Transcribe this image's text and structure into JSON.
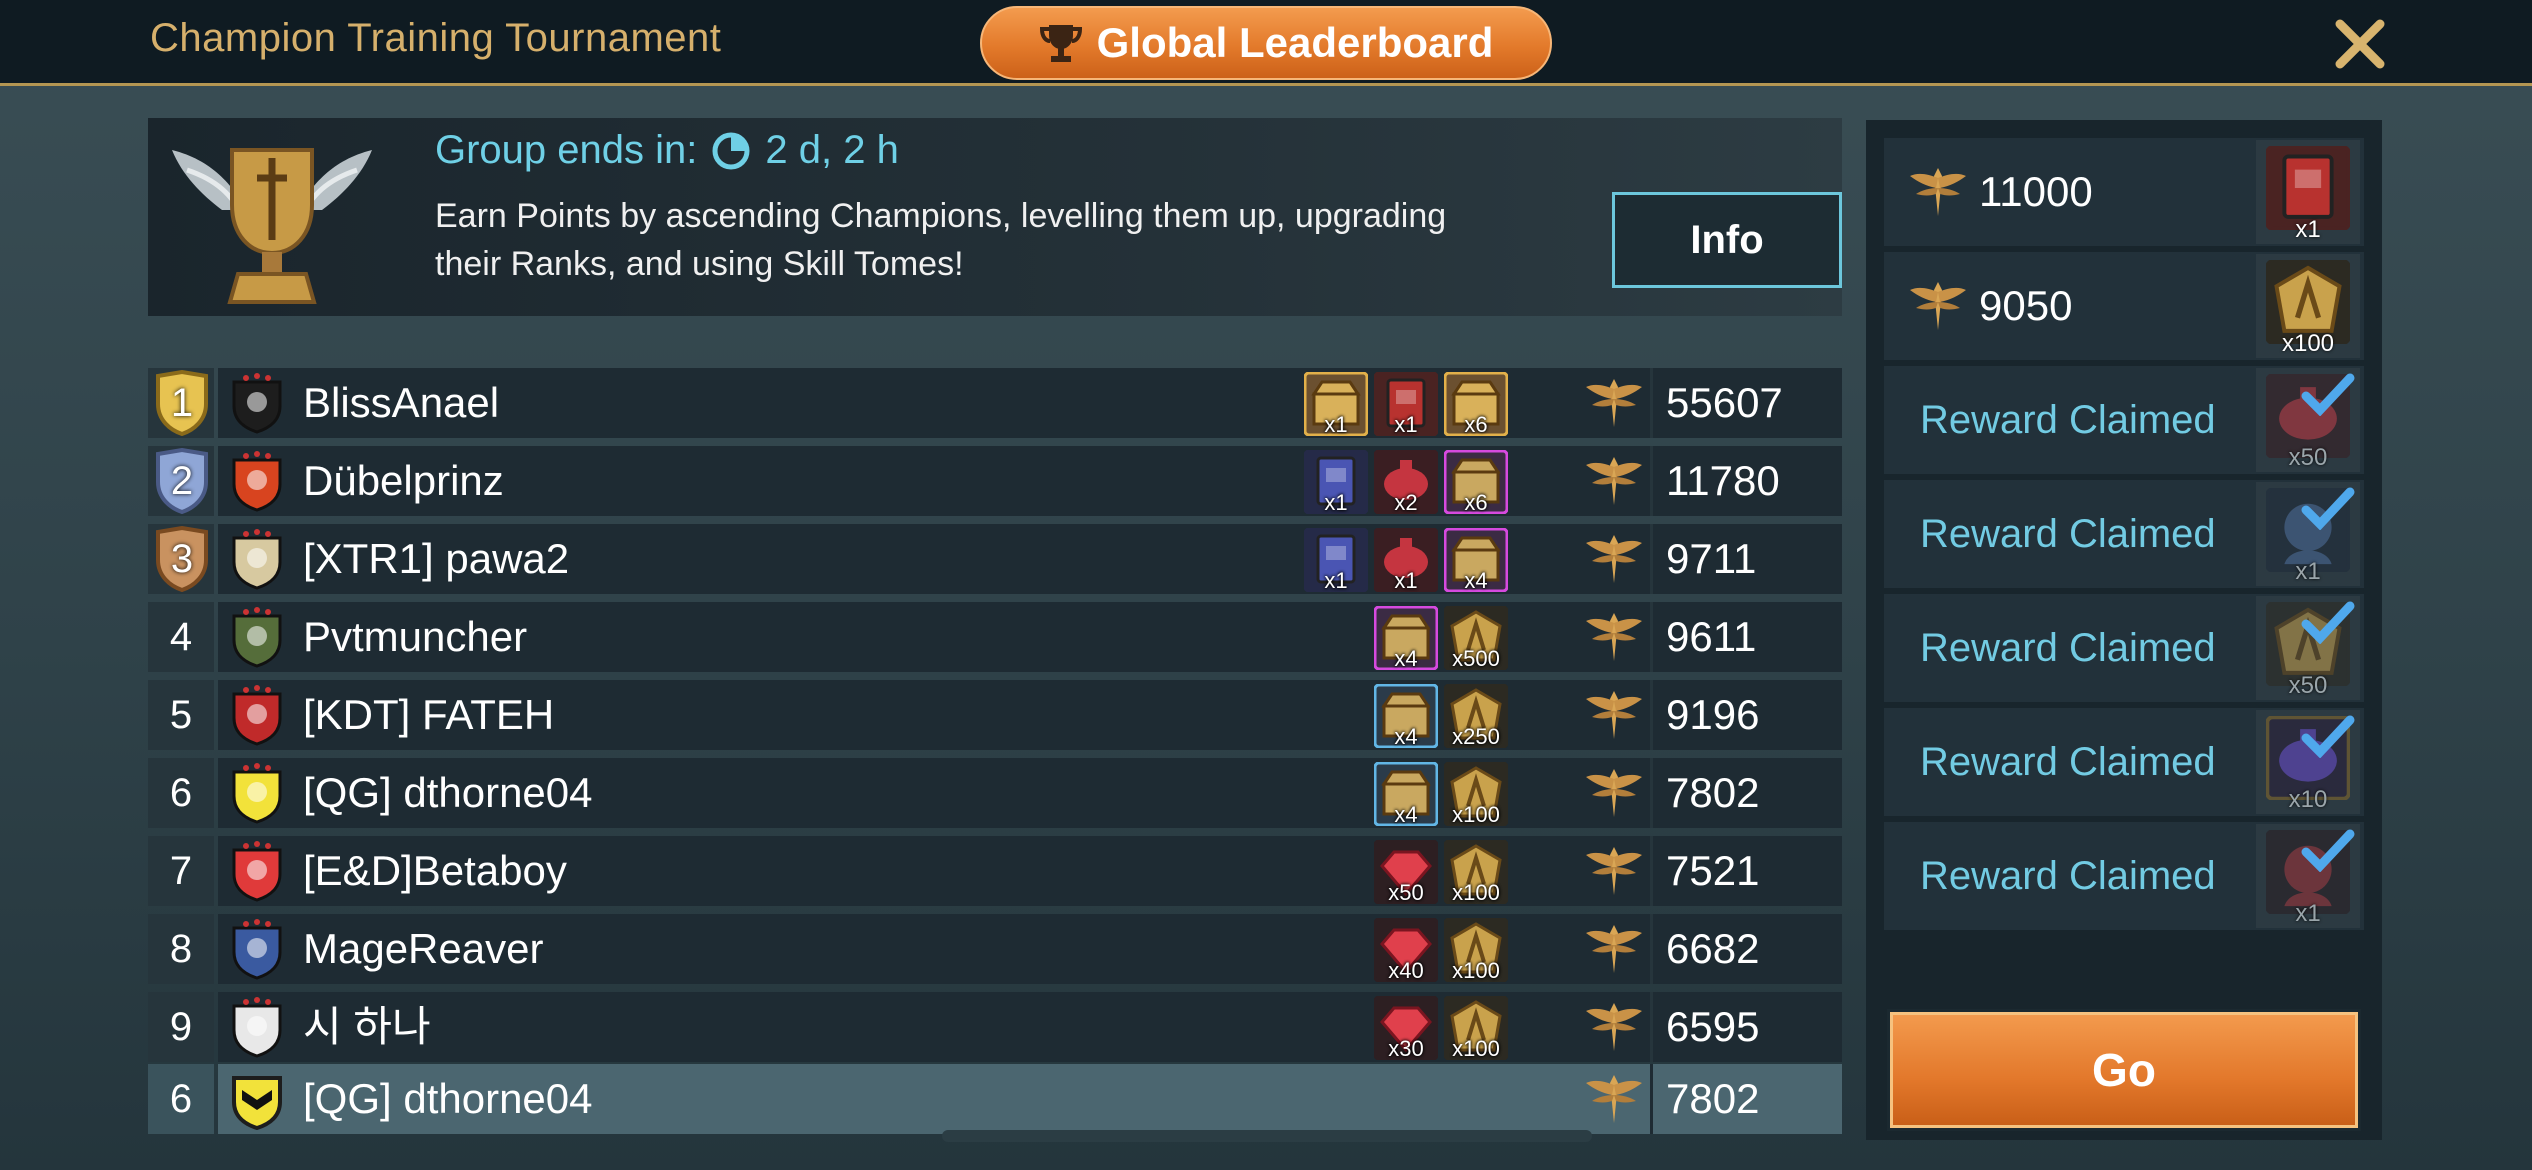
{
  "header": {
    "title": "Champion Training Tournament",
    "leaderboard_label": "Global Leaderboard",
    "close_icon": "close-icon"
  },
  "banner": {
    "ends_label": "Group ends in:",
    "ends_time": "2 d, 2 h",
    "description": "Earn Points by ascending Champions, levelling them up, upgrading their Ranks, and using Skill Tomes!",
    "info_label": "Info"
  },
  "leaderboard": [
    {
      "rank": "1",
      "name": "BlissAnael",
      "score": "55607",
      "rewards": [
        {
          "icon": "chest-gold",
          "qty": "x1"
        },
        {
          "icon": "tome-red",
          "qty": "x1"
        },
        {
          "icon": "chest-gold",
          "qty": "x6"
        }
      ]
    },
    {
      "rank": "2",
      "name": "Dübelprinz",
      "score": "11780",
      "rewards": [
        {
          "icon": "tome-blue",
          "qty": "x1"
        },
        {
          "icon": "potion-red",
          "qty": "x2"
        },
        {
          "icon": "chest-purple",
          "qty": "x6"
        }
      ]
    },
    {
      "rank": "3",
      "name": "[XTR1] pawa2",
      "score": "9711",
      "rewards": [
        {
          "icon": "tome-blue",
          "qty": "x1"
        },
        {
          "icon": "potion-red",
          "qty": "x1"
        },
        {
          "icon": "chest-purple",
          "qty": "x4"
        }
      ]
    },
    {
      "rank": "4",
      "name": "Pvtmuncher",
      "score": "9611",
      "rewards": [
        {
          "icon": "chest-purple",
          "qty": "x4"
        },
        {
          "icon": "token-gold",
          "qty": "x500"
        }
      ]
    },
    {
      "rank": "5",
      "name": "[KDT] FATEH",
      "score": "9196",
      "rewards": [
        {
          "icon": "chest-blue",
          "qty": "x4"
        },
        {
          "icon": "token-gold",
          "qty": "x250"
        }
      ]
    },
    {
      "rank": "6",
      "name": "[QG] dthorne04",
      "score": "7802",
      "rewards": [
        {
          "icon": "chest-blue",
          "qty": "x4"
        },
        {
          "icon": "token-gold",
          "qty": "x100"
        }
      ]
    },
    {
      "rank": "7",
      "name": "[E&D]Betaboy",
      "score": "7521",
      "rewards": [
        {
          "icon": "ruby",
          "qty": "x50"
        },
        {
          "icon": "token-gold",
          "qty": "x100"
        }
      ]
    },
    {
      "rank": "8",
      "name": "MageReaver",
      "score": "6682",
      "rewards": [
        {
          "icon": "ruby",
          "qty": "x40"
        },
        {
          "icon": "token-gold",
          "qty": "x100"
        }
      ]
    },
    {
      "rank": "9",
      "name": "시 하나",
      "score": "6595",
      "rewards": [
        {
          "icon": "ruby",
          "qty": "x30"
        },
        {
          "icon": "token-gold",
          "qty": "x100"
        }
      ]
    }
  ],
  "current_player": {
    "rank": "6",
    "name": "[QG] dthorne04",
    "score": "7802"
  },
  "milestones": [
    {
      "amount": "11000",
      "claimed": false,
      "icon": "tome-red",
      "qty": "x1"
    },
    {
      "amount": "9050",
      "claimed": false,
      "icon": "token-gold",
      "qty": "x100"
    },
    {
      "label": "Reward Claimed",
      "claimed": true,
      "icon": "potion-red",
      "qty": "x50"
    },
    {
      "label": "Reward Claimed",
      "claimed": true,
      "icon": "champion-blue",
      "qty": "x1"
    },
    {
      "label": "Reward Claimed",
      "claimed": true,
      "icon": "token-gold",
      "qty": "x50"
    },
    {
      "label": "Reward Claimed",
      "claimed": true,
      "icon": "potion-purple",
      "qty": "x10"
    },
    {
      "label": "Reward Claimed",
      "claimed": true,
      "icon": "champion-red",
      "qty": "x1"
    }
  ],
  "go_label": "Go",
  "colors": {
    "accent": "#e37a2b",
    "cyan": "#6fd0e6",
    "gold": "#d6b06c",
    "panel": "#1e2b33"
  }
}
